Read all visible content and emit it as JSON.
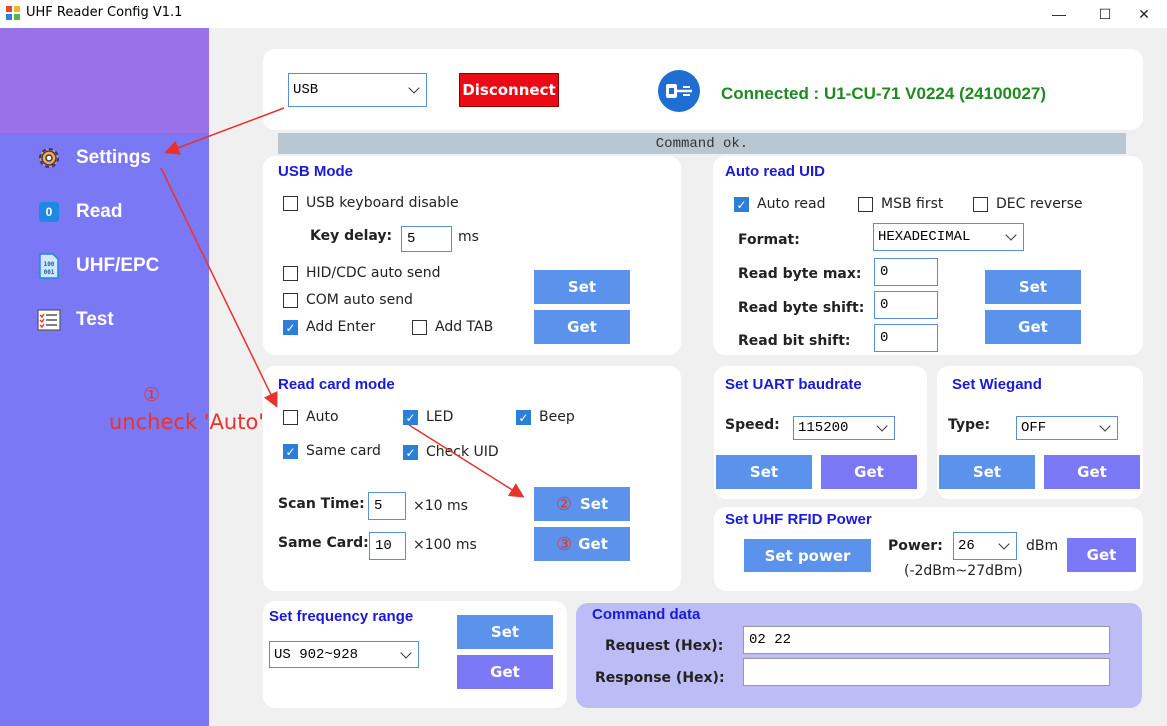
{
  "window": {
    "title": "UHF Reader Config V1.1",
    "minimize": "—",
    "maximize": "☐",
    "close": "✕"
  },
  "sidebar": {
    "items": [
      {
        "label": "Settings",
        "icon": "gear-icon"
      },
      {
        "label": "Read",
        "icon": "counter-icon",
        "icon_text": "0"
      },
      {
        "label": "UHF/EPC",
        "icon": "binary-file-icon"
      },
      {
        "label": "Test",
        "icon": "checklist-icon"
      }
    ]
  },
  "connection": {
    "port": "USB",
    "disconnect_label": "Disconnect",
    "status": "Connected : U1-CU-71 V0224 (24100027)",
    "message": "Command ok."
  },
  "usb_mode": {
    "title": "USB Mode",
    "keyboard_disable": "USB keyboard disable",
    "key_delay_label": "Key delay:",
    "key_delay": "5",
    "key_delay_unit": "ms",
    "hid_cdc": "HID/CDC auto send",
    "com_auto": "COM auto send",
    "add_enter": "Add Enter",
    "add_tab": "Add TAB",
    "set": "Set",
    "get": "Get"
  },
  "auto_read": {
    "title": "Auto read UID",
    "auto_read": "Auto read",
    "msb_first": "MSB first",
    "dec_reverse": "DEC reverse",
    "format_label": "Format:",
    "format": "HEXADECIMAL",
    "byte_max_label": "Read byte max:",
    "byte_max": "0",
    "byte_shift_label": "Read byte shift:",
    "byte_shift": "0",
    "bit_shift_label": "Read bit shift:",
    "bit_shift": "0",
    "set": "Set",
    "get": "Get"
  },
  "read_card": {
    "title": "Read card mode",
    "auto": "Auto",
    "led": "LED",
    "beep": "Beep",
    "same_card": "Same card",
    "check_uid": "Check UID",
    "scan_time_label": "Scan Time:",
    "scan_time": "5",
    "scan_time_unit": "×10 ms",
    "same_card_label": "Same Card:",
    "same_card_value": "10",
    "same_card_unit": "×100 ms",
    "set": "Set",
    "get": "Get"
  },
  "uart": {
    "title": "Set UART baudrate",
    "speed_label": "Speed:",
    "speed": "115200",
    "set": "Set",
    "get": "Get"
  },
  "wiegand": {
    "title": "Set Wiegand",
    "type_label": "Type:",
    "type": "OFF",
    "set": "Set",
    "get": "Get"
  },
  "power": {
    "title": "Set UHF RFID Power",
    "set_label": "Set power",
    "power_label": "Power:",
    "power": "26",
    "unit": "dBm",
    "range": "(-2dBm~27dBm)",
    "get": "Get"
  },
  "frequency": {
    "title": "Set frequency range",
    "range": "US 902~928",
    "set": "Set",
    "get": "Get"
  },
  "command": {
    "title": "Command data",
    "request_label": "Request (Hex):",
    "request": "02 22",
    "response_label": "Response (Hex):",
    "response": ""
  },
  "annotations": {
    "step1_marker": "①",
    "step1_text": "uncheck 'Auto'",
    "step2_marker": "②",
    "step3_marker": "③"
  },
  "colors": {
    "sidebar": "#7b78f5",
    "sidebar_top": "#9a71e6",
    "title": "#1a1ad8",
    "button": "#5b93ec",
    "status": "#1f8a1f",
    "annotation": "#e8322c"
  }
}
